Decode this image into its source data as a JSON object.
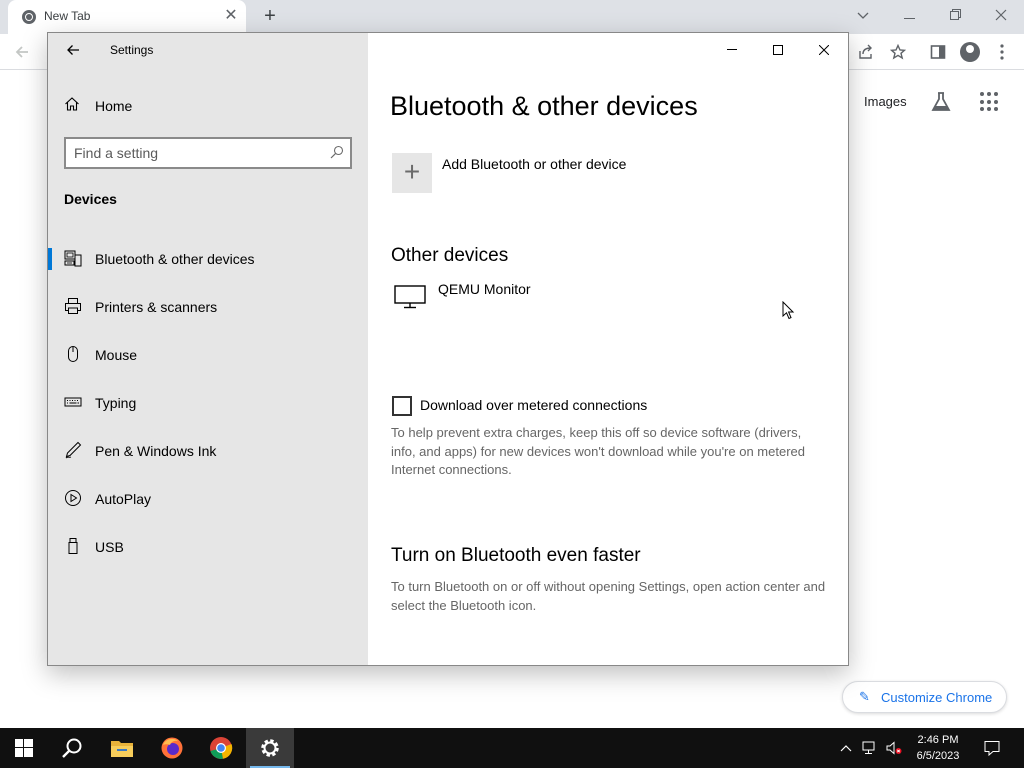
{
  "chrome": {
    "tab_title": "New Tab",
    "tab_close": "✕",
    "new_tab": "+",
    "images_link": "Images",
    "customize_label": "Customize Chrome"
  },
  "settings": {
    "window_title": "Settings",
    "nav_home": "Home",
    "search_placeholder": "Find a setting",
    "section": "Devices",
    "nav_items": [
      {
        "label": "Bluetooth & other devices",
        "icon": "bluetooth-devices-icon",
        "selected": true
      },
      {
        "label": "Printers & scanners",
        "icon": "printer-icon",
        "selected": false
      },
      {
        "label": "Mouse",
        "icon": "mouse-icon",
        "selected": false
      },
      {
        "label": "Typing",
        "icon": "keyboard-icon",
        "selected": false
      },
      {
        "label": "Pen & Windows Ink",
        "icon": "pen-icon",
        "selected": false
      },
      {
        "label": "AutoPlay",
        "icon": "autoplay-icon",
        "selected": false
      },
      {
        "label": "USB",
        "icon": "usb-icon",
        "selected": false
      }
    ],
    "page_title": "Bluetooth & other devices",
    "add_device_label": "Add Bluetooth or other device",
    "other_devices_heading": "Other devices",
    "other_devices": [
      {
        "name": "QEMU Monitor",
        "icon": "monitor-icon"
      }
    ],
    "metered": {
      "label": "Download over metered connections",
      "checked": false,
      "help": "To help prevent extra charges, keep this off so device software (drivers, info, and apps) for new devices won't download while you're on metered Internet connections."
    },
    "faster_heading": "Turn on Bluetooth even faster",
    "faster_help": "To turn Bluetooth on or off without opening Settings, open action center and select the Bluetooth icon.",
    "accent_color": "#0078d7"
  },
  "taskbar": {
    "time": "2:46 PM",
    "date": "6/5/2023",
    "apps": [
      "start-icon",
      "search-icon",
      "file-explorer-icon",
      "firefox-icon",
      "chrome-icon",
      "settings-icon"
    ]
  }
}
